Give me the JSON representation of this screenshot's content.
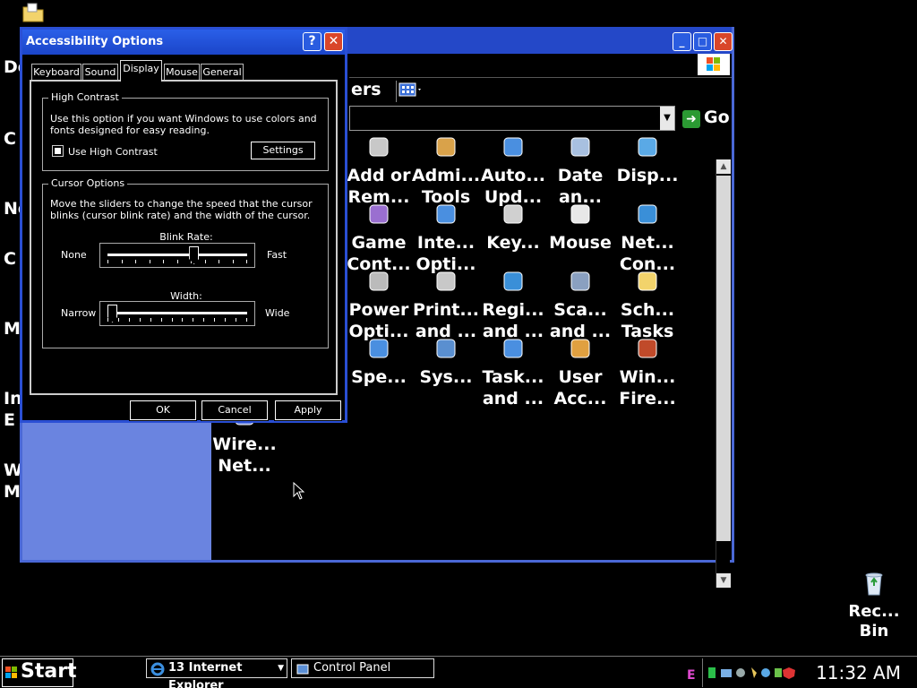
{
  "desktop": {
    "fragments": [
      "Do",
      "C",
      "Ne",
      "C",
      "M",
      "In",
      "E",
      "W",
      "M"
    ],
    "recycle_bin_label": "Rec...\nBin"
  },
  "control_panel": {
    "toolbar_label": "ers",
    "go_label": "Go",
    "items": [
      {
        "label": "Add or\nRem...",
        "icon": "add-remove-programs-icon"
      },
      {
        "label": "Admi...\nTools",
        "icon": "admin-tools-icon"
      },
      {
        "label": "Auto...\nUpd...",
        "icon": "automatic-updates-icon"
      },
      {
        "label": "Date\nan...",
        "icon": "date-time-icon"
      },
      {
        "label": "Disp...",
        "icon": "display-icon"
      },
      {
        "label": "Game\nCont...",
        "icon": "game-controllers-icon"
      },
      {
        "label": "Inte...\nOpti...",
        "icon": "internet-options-icon"
      },
      {
        "label": "Key...",
        "icon": "keyboard-icon"
      },
      {
        "label": "Mouse",
        "icon": "mouse-icon"
      },
      {
        "label": "Net...\nCon...",
        "icon": "network-connections-icon"
      },
      {
        "label": "Power\nOpti...",
        "icon": "power-options-icon"
      },
      {
        "label": "Print...\nand ...",
        "icon": "printers-faxes-icon"
      },
      {
        "label": "Regi...\nand ...",
        "icon": "regional-language-icon"
      },
      {
        "label": "Sca...\nand ...",
        "icon": "scanners-cameras-icon"
      },
      {
        "label": "Sch...\nTasks",
        "icon": "scheduled-tasks-icon"
      },
      {
        "label": "Spe...",
        "icon": "speech-icon"
      },
      {
        "label": "Sys...",
        "icon": "system-icon"
      },
      {
        "label": "Task...\nand ...",
        "icon": "taskbar-start-menu-icon"
      },
      {
        "label": "User\nAcc...",
        "icon": "user-accounts-icon"
      },
      {
        "label": "Win...\nFire...",
        "icon": "windows-firewall-icon"
      },
      {
        "label": "Wire...\nNet...",
        "icon": "wireless-network-icon"
      }
    ]
  },
  "dialog": {
    "title": "Accessibility Options",
    "tabs": [
      "Keyboard",
      "Sound",
      "Display",
      "Mouse",
      "General"
    ],
    "active_tab": "Display",
    "high_contrast": {
      "group_title": "High Contrast",
      "description": "Use this option if you want Windows to use colors and fonts designed for easy reading.",
      "checkbox_label": "Use High Contrast",
      "checked": true,
      "settings_button": "Settings"
    },
    "cursor_options": {
      "group_title": "Cursor Options",
      "description": "Move the sliders to change the speed that the cursor blinks (cursor blink rate) and the width of the cursor.",
      "blink_rate_label": "Blink Rate:",
      "blink_min": "None",
      "blink_max": "Fast",
      "blink_value": 0.62,
      "width_label": "Width:",
      "width_min": "Narrow",
      "width_max": "Wide",
      "width_value": 0.0
    },
    "buttons": {
      "ok": "OK",
      "cancel": "Cancel",
      "apply": "Apply"
    }
  },
  "taskbar": {
    "start_label": "Start",
    "ie_task": "13 Internet Explorer",
    "cp_task": "Control Panel",
    "clock": "11:32 AM"
  },
  "colors": {
    "titlebar": "#2448c8",
    "close": "#d9462a",
    "panel": "#6a84e0"
  }
}
